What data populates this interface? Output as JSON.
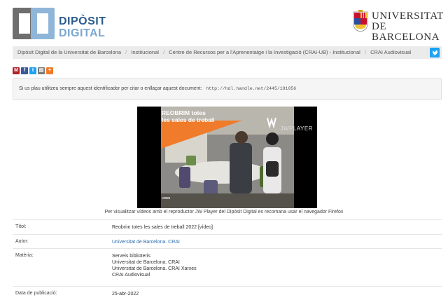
{
  "header": {
    "logo_line1": "DIPÒSIT",
    "logo_line2": "DIGITAL",
    "university_line1": "UNIVERSITAT DE",
    "university_line2": "BARCELONA"
  },
  "breadcrumb": [
    "Dipòsit Digital de la Universitat de Barcelona",
    "Institucional",
    "Centre de Recursos per a l'Aprenentatge i la Investigació (CRAI-UB) - Institucional",
    "CRAI Audiovisual"
  ],
  "share_icons": [
    "mendeley-icon",
    "facebook-icon",
    "twitter-icon",
    "print-icon",
    "plus-icon"
  ],
  "handle": {
    "text": "Si us plau utilitzeu sempre aquest identificador per citar o enllaçar aquest document:",
    "url": "http://hdl.handle.net/2445/191056"
  },
  "video": {
    "title_line1": "REOBRIM totes",
    "title_line2": "les sales de treball",
    "player_label": "JWPLAYER",
    "watermark": "CRAI",
    "note": "Per visualitzar vídeos amb el reproductor JW Player del Dipòsit Digital es recomana usar el navegador Firefox"
  },
  "metadata": {
    "title_label": "Títol:",
    "title_value": "Reobrim totes les sales de treball 2022 [vídeo]",
    "author_label": "Autor:",
    "author_value": "Universitat de Barcelona. CRAI",
    "subject_label": "Matèria:",
    "subject_values": [
      "Serveis biblioteris",
      "Universitat de Barcelona. CRAI",
      "Universitat de Barcelona. CRAI Xarxes",
      "CRAI Audiovisual"
    ],
    "date_label": "Data de publicació:",
    "date_value": "25-abr-2022"
  },
  "colors": {
    "brand_blue": "#2b5d8f",
    "link_blue": "#2b6cb0",
    "twitter": "#1da1f2",
    "accent_orange": "#f07b2a"
  }
}
